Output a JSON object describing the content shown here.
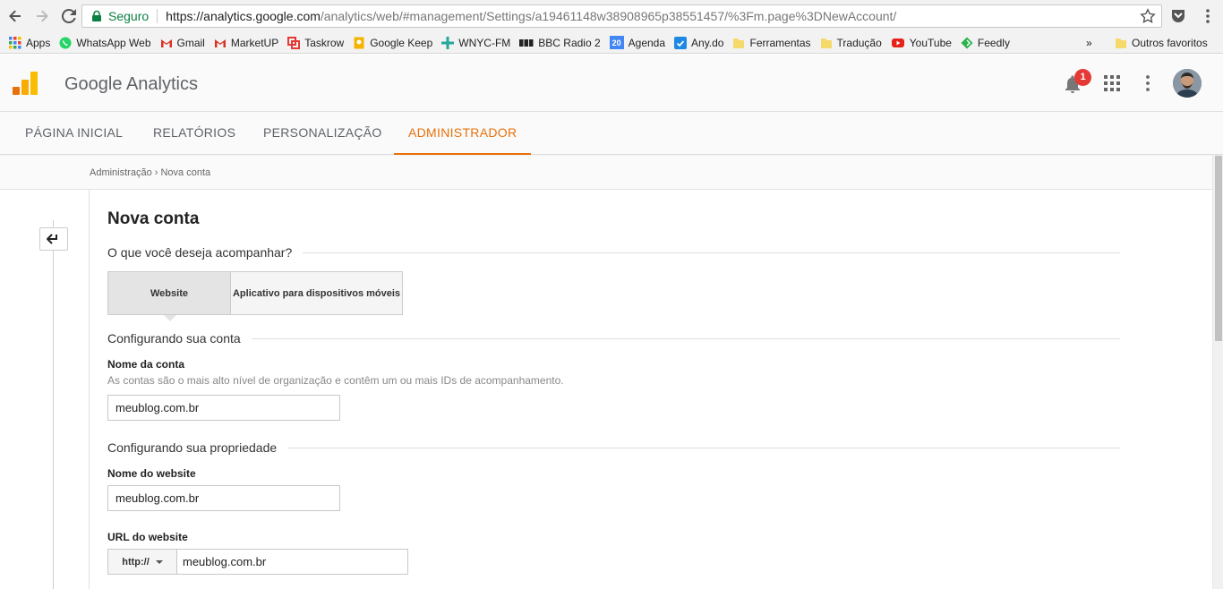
{
  "browser": {
    "secure_label": "Seguro",
    "url_host": "https://analytics.google.com",
    "url_path": "/analytics/web/#management/Settings/a19461148w38908965p38551457/%3Fm.page%3DNewAccount/"
  },
  "bookmarks": {
    "items": [
      {
        "label": "Apps",
        "icon": "apps-grid-icon",
        "color": "#4285f4"
      },
      {
        "label": "WhatsApp Web",
        "icon": "whatsapp-icon",
        "color": "#25d366"
      },
      {
        "label": "Gmail",
        "icon": "gmail-icon",
        "color": "#d93025"
      },
      {
        "label": "MarketUP",
        "icon": "gmail-icon",
        "color": "#d93025"
      },
      {
        "label": "Taskrow",
        "icon": "taskrow-icon",
        "color": "#e53935"
      },
      {
        "label": "Google Keep",
        "icon": "keep-icon",
        "color": "#f6b400"
      },
      {
        "label": "WNYC-FM",
        "icon": "wnyc-icon",
        "color": "#26a69a"
      },
      {
        "label": "BBC Radio 2",
        "icon": "bbc-icon",
        "color": "#222222"
      },
      {
        "label": "Agenda",
        "icon": "calendar-icon",
        "color": "#4285f4",
        "badge": "20"
      },
      {
        "label": "Any.do",
        "icon": "anydo-icon",
        "color": "#1e88e5"
      },
      {
        "label": "Ferramentas",
        "icon": "folder-icon",
        "color": "#f6d96b"
      },
      {
        "label": "Tradução",
        "icon": "folder-icon",
        "color": "#f6d96b"
      },
      {
        "label": "YouTube",
        "icon": "youtube-icon",
        "color": "#e62117"
      },
      {
        "label": "Feedly",
        "icon": "feedly-icon",
        "color": "#2bb24c"
      }
    ],
    "overflow": "»",
    "other": "Outros favoritos"
  },
  "ga": {
    "title": "Google Analytics",
    "notification_count": "1",
    "tabs": [
      {
        "label": "PÁGINA INICIAL"
      },
      {
        "label": "RELATÓRIOS"
      },
      {
        "label": "PERSONALIZAÇÃO"
      },
      {
        "label": "ADMINISTRADOR"
      }
    ],
    "accent": "#e8710a"
  },
  "breadcrumb": "Administração › Nova conta",
  "form": {
    "title": "Nova conta",
    "track_heading": "O que você deseja acompanhar?",
    "options": [
      "Website",
      "Aplicativo para dispositivos móveis"
    ],
    "account_heading": "Configurando sua conta",
    "account_name_label": "Nome da conta",
    "account_name_help": "As contas são o mais alto nível de organização e contêm um ou mais IDs de acompanhamento.",
    "account_name_value": "meublog.com.br",
    "property_heading": "Configurando sua propriedade",
    "website_name_label": "Nome do website",
    "website_name_value": "meublog.com.br",
    "website_url_label": "URL do website",
    "protocol_value": "http://",
    "website_url_value": "meublog.com.br"
  }
}
